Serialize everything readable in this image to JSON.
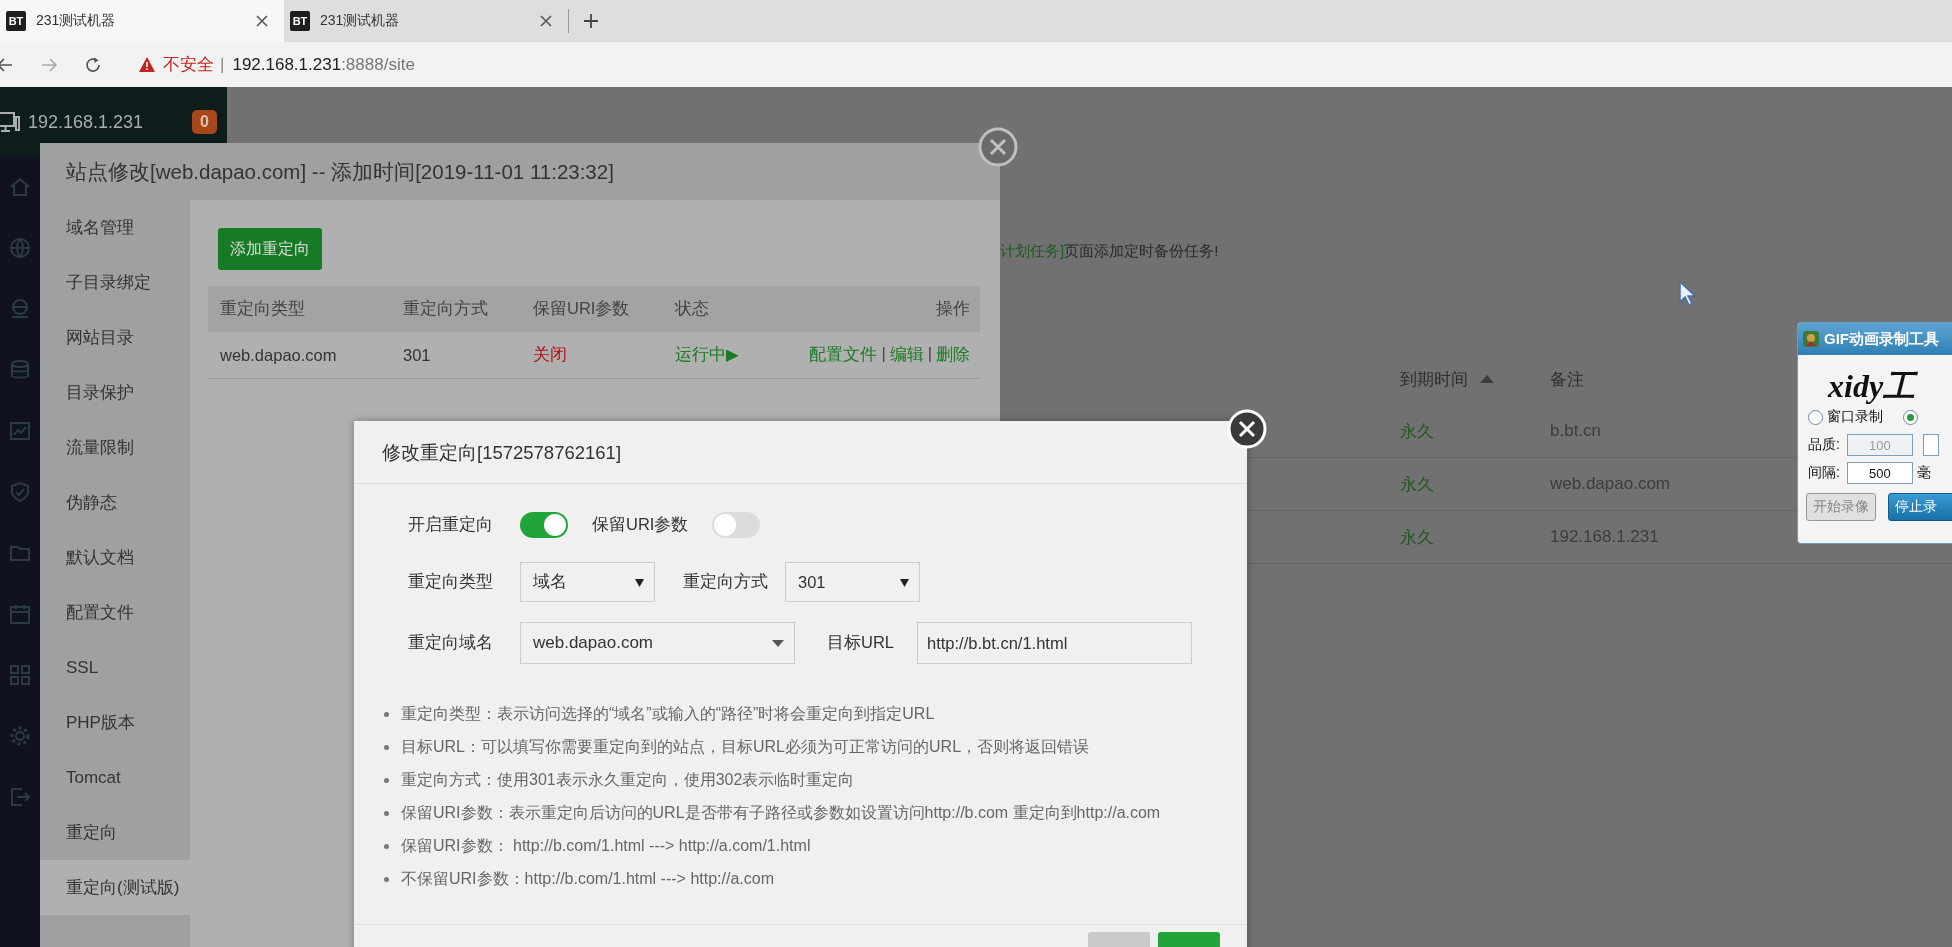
{
  "browser": {
    "tabs": [
      {
        "favicon": "BT",
        "title": "231测试机器",
        "selected": true
      },
      {
        "favicon": "BT",
        "title": "231测试机器",
        "selected": false
      }
    ],
    "address": {
      "security": "不安全",
      "separator": "|",
      "host": "192.168.1.231",
      "path": ":8888/site"
    }
  },
  "sidebar": {
    "host": "192.168.1.231",
    "badge": "0"
  },
  "page": {
    "notice_link": "计划任务]",
    "notice_text": "页面添加定时备份任务!",
    "table": {
      "columns": [
        "到期时间",
        "备注"
      ],
      "rows": [
        {
          "expiry": "永久",
          "note": "b.bt.cn"
        },
        {
          "expiry": "永久",
          "note": "web.dapao.com"
        },
        {
          "expiry": "永久",
          "note": "192.168.1.231"
        }
      ]
    }
  },
  "site_dialog": {
    "title": "站点修改[web.dapao.com] -- 添加时间[2019-11-01 11:23:32]",
    "menu": [
      {
        "label": "域名管理",
        "selected": false
      },
      {
        "label": "子目录绑定",
        "selected": false
      },
      {
        "label": "网站目录",
        "selected": false
      },
      {
        "label": "目录保护",
        "selected": false
      },
      {
        "label": "流量限制",
        "selected": false
      },
      {
        "label": "伪静态",
        "selected": false
      },
      {
        "label": "默认文档",
        "selected": false
      },
      {
        "label": "配置文件",
        "selected": false
      },
      {
        "label": "SSL",
        "selected": false
      },
      {
        "label": "PHP版本",
        "selected": false
      },
      {
        "label": "Tomcat",
        "selected": false
      },
      {
        "label": "重定向",
        "selected": false
      },
      {
        "label": "重定向(测试版)",
        "selected": true
      }
    ],
    "add_button": "添加重定向",
    "table": {
      "columns": [
        "重定向类型",
        "重定向方式",
        "保留URI参数",
        "状态",
        "操作"
      ],
      "rows": [
        {
          "type": "web.dapao.com",
          "method": "301",
          "keep_uri": {
            "text": "关闭",
            "on": false
          },
          "status": {
            "text": "运行中▶",
            "running": true
          },
          "actions": [
            "配置文件",
            "编辑",
            "删除"
          ],
          "action_separator": "|"
        }
      ]
    }
  },
  "redirect_dialog": {
    "title": "修改重定向[1572578762161]",
    "enable": {
      "label": "开启重定向",
      "on": true
    },
    "keep_uri": {
      "label": "保留URI参数",
      "on": false
    },
    "type": {
      "label": "重定向类型",
      "value": "域名"
    },
    "method": {
      "label": "重定向方式",
      "value": "301"
    },
    "domain": {
      "label": "重定向域名",
      "value": "web.dapao.com"
    },
    "target": {
      "label": "目标URL",
      "value": "http://b.bt.cn/1.html"
    },
    "notes": [
      "重定向类型：表示访问选择的“域名”或输入的“路径”时将会重定向到指定URL",
      "目标URL：可以填写你需要重定向到的站点，目标URL必须为可正常访问的URL，否则将返回错误",
      "重定向方式：使用301表示永久重定向，使用302表示临时重定向",
      "保留URI参数：表示重定向后访问的URL是否带有子路径或参数如设置访问http://b.com 重定向到http://a.com",
      "保留URI参数：  http://b.com/1.html ---> http://a.com/1.html",
      "不保留URI参数：http://b.com/1.html ---> http://a.com"
    ]
  },
  "gif_tool": {
    "title": "GIF动画录制工具",
    "logo": "xidy工",
    "radios": [
      {
        "label": "窗口录制",
        "selected": false
      },
      {
        "selected": true
      }
    ],
    "quality_label": "品质:",
    "quality": "100",
    "interval_label": "间隔:",
    "interval": "500",
    "interval_unit": "毫",
    "start_button": "开始录像",
    "stop_button": "停止录"
  }
}
